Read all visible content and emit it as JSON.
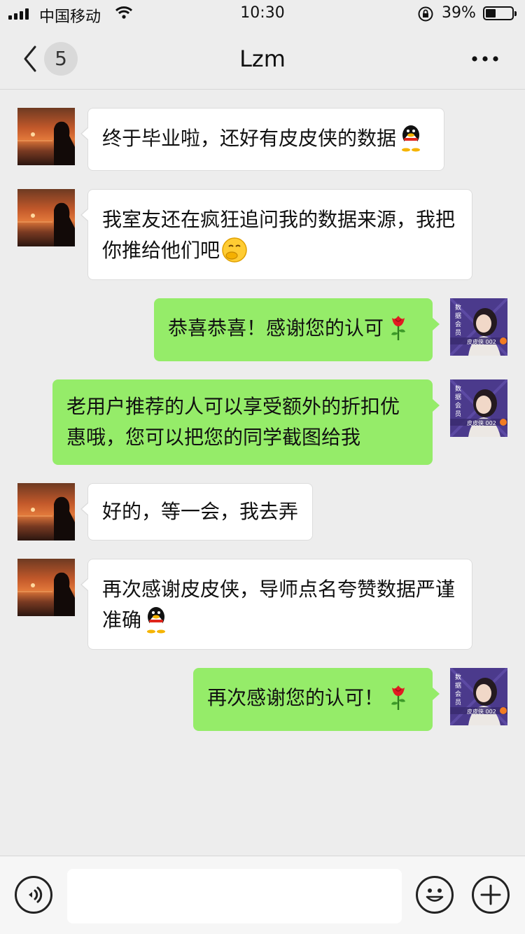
{
  "status_bar": {
    "carrier": "中国移动",
    "time": "10:30",
    "battery_percent_label": "39%",
    "battery_level": 0.39,
    "icons": [
      "signal-icon",
      "wifi-icon",
      "rotation-lock-icon",
      "battery-icon"
    ]
  },
  "nav": {
    "back_icon": "chevron-left-icon",
    "unread_count": "5",
    "title": "Lzm",
    "more_icon": "more-dots-icon"
  },
  "avatars": {
    "other": {
      "description_icon": "sunset-silhouette-avatar"
    },
    "self": {
      "text_vertical": "数据会员",
      "caption": "皮皮侠 002",
      "accent": "#4b3a8c"
    }
  },
  "messages": [
    {
      "side": "in",
      "text": "终于毕业啦，还好有皮皮侠的数据",
      "emoji": "penguin-emoji"
    },
    {
      "side": "in",
      "text": "我室友还在疯狂追问我的数据来源，我把你推给他们吧",
      "emoji": "hand-over-mouth-emoji"
    },
    {
      "side": "out",
      "text": "恭喜恭喜！感谢您的认可",
      "emoji": "rose-emoji"
    },
    {
      "side": "out",
      "text": "老用户推荐的人可以享受额外的折扣优惠哦，您可以把您的同学截图给我",
      "emoji": ""
    },
    {
      "side": "in",
      "text": "好的，等一会，我去弄",
      "emoji": ""
    },
    {
      "side": "in",
      "text": "再次感谢皮皮侠，导师点名夸赞数据严谨准确",
      "emoji": "penguin-emoji"
    },
    {
      "side": "out",
      "text": "再次感谢您的认可！",
      "emoji": "rose-emoji"
    }
  ],
  "input_bar": {
    "voice_icon": "voice-icon",
    "input_value": "",
    "emoji_icon": "smiley-icon",
    "plus_icon": "plus-icon"
  },
  "colors": {
    "background": "#ededed",
    "outgoing_bubble": "#95ec69",
    "incoming_bubble": "#ffffff"
  }
}
